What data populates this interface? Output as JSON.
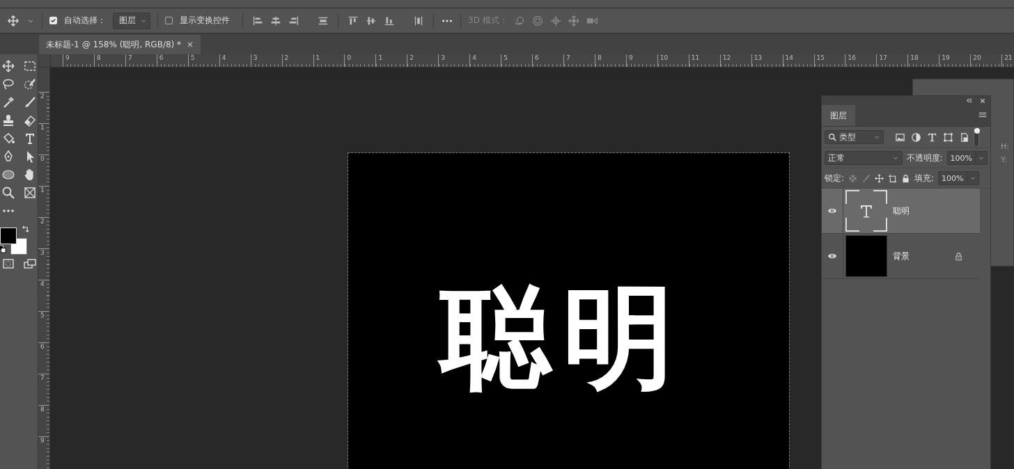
{
  "options_bar": {
    "auto_select": {
      "label": "自动选择：",
      "checked": true
    },
    "target": "图层",
    "show_transform": {
      "label": "显示变换控件",
      "checked": false
    },
    "mode_3d_label": "3D 模式："
  },
  "document_tabs": [
    {
      "title": "未标题-1 @ 158% (聪明, RGB/8) *",
      "selected": true,
      "close": "×"
    }
  ],
  "rulers": {
    "horizontal": [
      "9",
      "8",
      "7",
      "6",
      "5",
      "4",
      "3",
      "2",
      "1",
      "0",
      "1",
      "2",
      "3",
      "4",
      "5",
      "6",
      "7",
      "8",
      "9",
      "10",
      "11",
      "12",
      "13",
      "14",
      "15",
      "16",
      "17",
      "18",
      "19",
      "20",
      "21"
    ],
    "vertical": [
      "2",
      "1",
      "0",
      "1",
      "2",
      "3",
      "4",
      "5",
      "6",
      "7",
      "8",
      "9"
    ]
  },
  "canvas": {
    "text": "聪明"
  },
  "back_panel": {
    "labels": [
      "H:",
      "Y:"
    ]
  },
  "layers_panel": {
    "tab": "图层",
    "filter": "类型",
    "filter_enabled": true,
    "blend_mode": "正常",
    "opacity_label": "不透明度:",
    "opacity": "100%",
    "lock_label": "锁定:",
    "fill_label": "填充:",
    "fill": "100%",
    "layers": [
      {
        "name": "聪明",
        "kind": "text",
        "visible": true,
        "selected": true,
        "locked": false
      },
      {
        "name": "背景",
        "kind": "fill",
        "visible": true,
        "selected": false,
        "locked": true
      }
    ]
  }
}
